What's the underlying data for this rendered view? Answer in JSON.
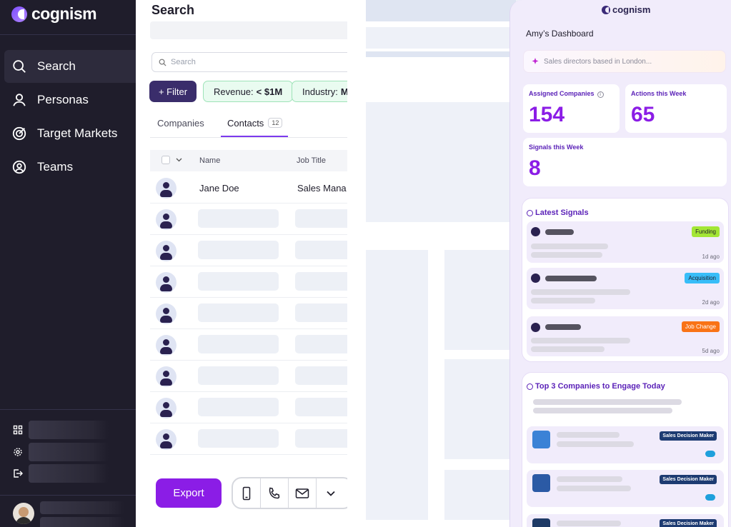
{
  "sidebar": {
    "brand": "cognism",
    "items": [
      {
        "label": "Search",
        "icon": "search-icon",
        "active": true
      },
      {
        "label": "Personas",
        "icon": "user-icon"
      },
      {
        "label": "Target Markets",
        "icon": "target-icon"
      },
      {
        "label": "Teams",
        "icon": "teams-icon"
      }
    ],
    "bottom_icons": [
      "grid-icon",
      "gear-icon",
      "logout-icon"
    ]
  },
  "search_panel": {
    "title": "Search",
    "search_placeholder": "Search",
    "filter_button": "+ Filter",
    "chips": [
      {
        "label": "Revenue:",
        "value": "< $1M"
      },
      {
        "label": "Industry:",
        "value": "M"
      }
    ],
    "tabs": [
      {
        "label": "Companies"
      },
      {
        "label": "Contacts",
        "badge": "12",
        "active": true
      }
    ],
    "columns": [
      "Name",
      "Job Title"
    ],
    "first_row": {
      "name": "Jane Doe",
      "job_title": "Sales Mana"
    },
    "export_button": "Export",
    "actions": [
      "mobile-icon",
      "phone-icon",
      "email-icon",
      "chevron-down-icon"
    ]
  },
  "dashboard": {
    "brand": "cognism",
    "title": "Amy’s Dashboard",
    "ai_placeholder": "Sales directors based in London...",
    "stats": {
      "assigned_label": "Assigned Companies",
      "assigned_value": "154",
      "actions_label": "Actions this Week",
      "actions_value": "65",
      "signals_label": "Signals this Week",
      "signals_value": "8"
    },
    "latest_signals_title": "Latest Signals",
    "signals": [
      {
        "tag": "Funding",
        "tag_color": "#a3e635",
        "time": "1d ago"
      },
      {
        "tag": "Acquisition",
        "tag_color": "#38bdf8",
        "time": "2d ago"
      },
      {
        "tag": "Job Change",
        "tag_color": "#f97316",
        "time": "5d ago"
      }
    ],
    "top_companies_title": "Top 3 Companies to Engage Today",
    "companies": [
      {
        "tag": "Sales Decision Maker",
        "logo_color": "#3b82d6"
      },
      {
        "tag": "Sales Decision Maker",
        "logo_color": "#2b5aa5"
      },
      {
        "tag": "Sales Decision Maker",
        "logo_color": "#1e3a66"
      }
    ]
  },
  "colors": {
    "sidebar_bg": "#1f1d2b",
    "accent_purple": "#8b1de6",
    "filter_bg": "#3a2d6b"
  }
}
